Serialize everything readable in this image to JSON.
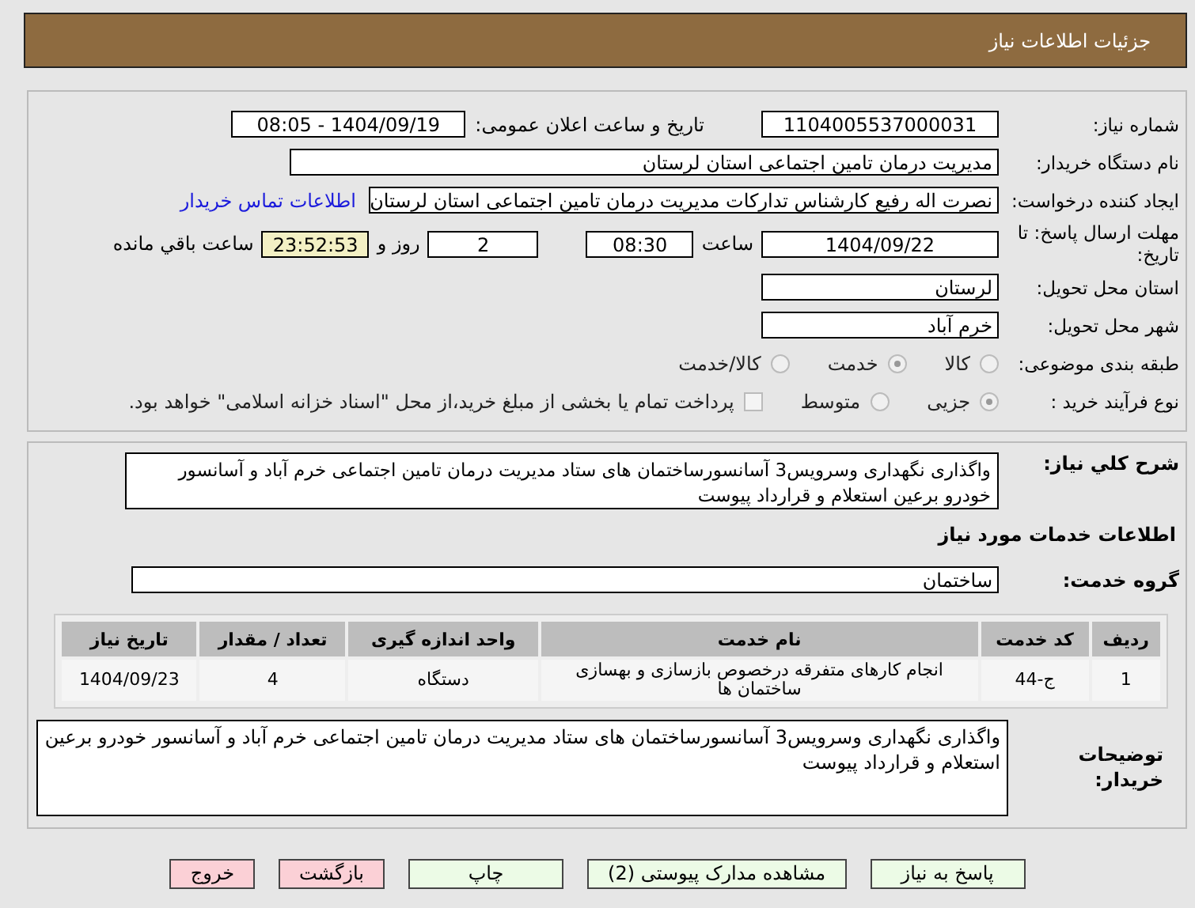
{
  "header": {
    "title": "جزئیات اطلاعات نیاز"
  },
  "details": {
    "need_number": {
      "label": "شماره نیاز:",
      "value": "1104005537000031"
    },
    "announce": {
      "label": "تاریخ و ساعت اعلان عمومی:",
      "value": "1404/09/19 - 08:05"
    },
    "buyer": {
      "label": "نام دستگاه خریدار:",
      "value": "مدیریت درمان تامین اجتماعی استان لرستان"
    },
    "creator": {
      "label": "ایجاد کننده درخواست:",
      "value": "نصرت اله رفیع کارشناس تدارکات مدیریت درمان تامین اجتماعی استان لرستان",
      "link": "اطلاعات تماس خریدار"
    },
    "deadline": {
      "label": "مهلت ارسال پاسخ: تا تاریخ:",
      "date": "1404/09/22",
      "time_label": "ساعت",
      "time": "08:30",
      "days": "2",
      "days_label": "روز و",
      "remaining": "23:52:53",
      "remaining_label": "ساعت باقي مانده"
    },
    "province": {
      "label": "استان محل تحویل:",
      "value": "لرستان"
    },
    "city": {
      "label": "شهر محل تحویل:",
      "value": "خرم آباد"
    },
    "category": {
      "label": "طبقه بندی موضوعی:",
      "options": [
        {
          "label": "کالا",
          "selected": false
        },
        {
          "label": "خدمت",
          "selected": true
        },
        {
          "label": "کالا/خدمت",
          "selected": false
        }
      ]
    },
    "process": {
      "label": "نوع فرآیند خرید :",
      "options": [
        {
          "label": "جزیی",
          "selected": true
        },
        {
          "label": "متوسط",
          "selected": false
        }
      ],
      "payment": {
        "checked": false,
        "label": "پرداخت تمام یا بخشی از مبلغ خرید،از محل \"اسناد خزانه اسلامی\" خواهد بود."
      }
    }
  },
  "services": {
    "summary": {
      "label": "شرح کلي نياز:",
      "value": "واگذاری نگهداری وسرویس3 آسانسورساختمان های ستاد مدیریت درمان تامین اجتماعی خرم آباد و آسانسور خودرو برعین استعلام و قرارداد پیوست"
    },
    "heading": "اطلاعات خدمات مورد نیاز",
    "group": {
      "label": "گروه خدمت:",
      "value": "ساختمان"
    },
    "table": {
      "columns": [
        "ردیف",
        "کد خدمت",
        "نام خدمت",
        "واحد اندازه گیری",
        "تعداد / مقدار",
        "تاریخ نیاز"
      ],
      "rows": [
        [
          "1",
          "ج-44",
          "انجام کارهای متفرقه درخصوص بازسازی و بهسازی ساختمان ها",
          "دستگاه",
          "4",
          "1404/09/23"
        ]
      ]
    },
    "notes": {
      "label": "توضیحات خریدار:",
      "value": "واگذاری نگهداری وسرویس3 آسانسورساختمان های ستاد مدیریت درمان تامین اجتماعی خرم آباد و آسانسور خودرو برعین استعلام و قرارداد پیوست"
    }
  },
  "buttons": [
    {
      "label": "پاسخ به نیاز",
      "kind": "primary"
    },
    {
      "label": "مشاهده مدارک پیوستی (2)",
      "kind": "primary"
    },
    {
      "label": "چاپ",
      "kind": "primary"
    },
    {
      "label": "بازگشت",
      "kind": "danger"
    },
    {
      "label": "خروج",
      "kind": "danger"
    }
  ]
}
